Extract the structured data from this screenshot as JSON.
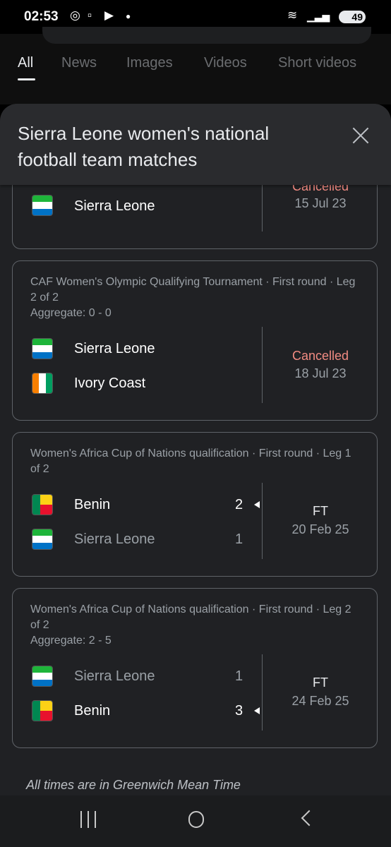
{
  "status_bar": {
    "time": "02:53",
    "battery": "49"
  },
  "tabs": [
    {
      "label": "All"
    },
    {
      "label": "News"
    },
    {
      "label": "Images"
    },
    {
      "label": "Videos"
    },
    {
      "label": "Short videos"
    }
  ],
  "sheet": {
    "title": "Sierra Leone women's national football team matches"
  },
  "matches": [
    {
      "competition": "",
      "team1": {
        "name": "",
        "flag": "sierra-leone"
      },
      "team2": {
        "name": "Sierra Leone",
        "flag": "sierra-leone"
      },
      "status": "Cancelled",
      "date": "15 Jul 23"
    },
    {
      "competition": "CAF Women's Olympic Qualifying Tournament · First round · Leg 2 of 2",
      "aggregate": "Aggregate: 0 - 0",
      "team1": {
        "name": "Sierra Leone",
        "flag": "sierra-leone"
      },
      "team2": {
        "name": "Ivory Coast",
        "flag": "ivory-coast"
      },
      "status": "Cancelled",
      "date": "18 Jul 23"
    },
    {
      "competition": "Women's Africa Cup of Nations qualification · First round · Leg 1 of 2",
      "team1": {
        "name": "Benin",
        "flag": "benin",
        "score": "2"
      },
      "team2": {
        "name": "Sierra Leone",
        "flag": "sierra-leone",
        "score": "1"
      },
      "status": "FT",
      "date": "20 Feb 25"
    },
    {
      "competition": "Women's Africa Cup of Nations qualification · First round · Leg 2 of 2",
      "aggregate": "Aggregate: 2 - 5",
      "team1": {
        "name": "Sierra Leone",
        "flag": "sierra-leone",
        "score": "1"
      },
      "team2": {
        "name": "Benin",
        "flag": "benin",
        "score": "3"
      },
      "status": "FT",
      "date": "24 Feb 25"
    }
  ],
  "footnote": "All times are in Greenwich Mean Time",
  "colors": {
    "cancelled": "#f28b82",
    "background": "#202124",
    "border": "#5f6368"
  }
}
